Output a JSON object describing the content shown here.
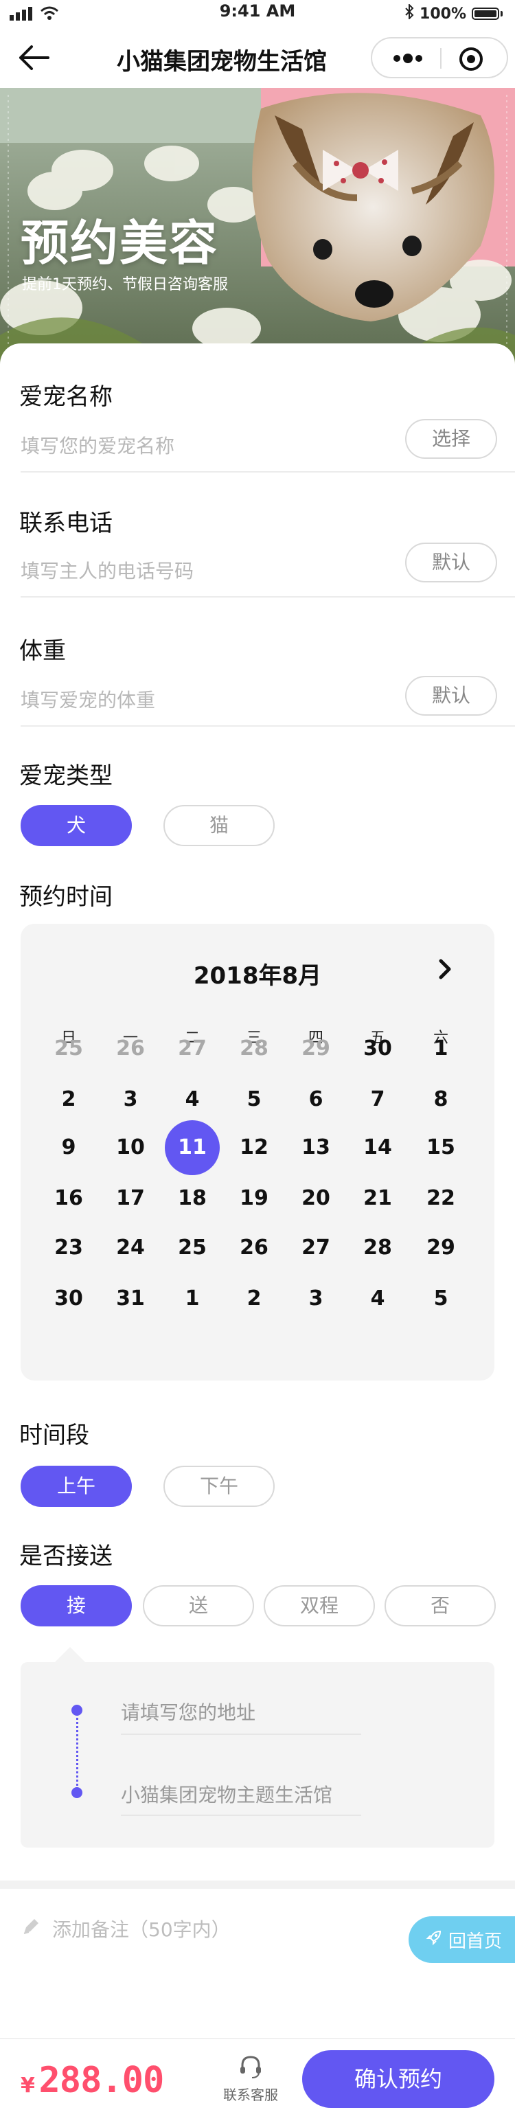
{
  "status_bar": {
    "time": "9:41 AM",
    "battery": "100%",
    "signal_icon": "signal-icon",
    "wifi_icon": "wifi-icon",
    "bluetooth_icon": "bluetooth-icon"
  },
  "nav": {
    "title": "小猫集团宠物生活馆",
    "back_icon": "back-arrow-icon",
    "more_icon": "more-dots-icon",
    "close_icon": "close-target-icon"
  },
  "hero": {
    "title": "预约美容",
    "subtitle": "提前1天预约、节假日咨询客服"
  },
  "form": {
    "pet_name": {
      "label": "爱宠名称",
      "placeholder": "填写您的爱宠名称",
      "button": "选择"
    },
    "phone": {
      "label": "联系电话",
      "placeholder": "填写主人的电话号码",
      "button": "默认"
    },
    "weight": {
      "label": "体重",
      "placeholder": "填写爱宠的体重",
      "button": "默认"
    },
    "pet_type": {
      "label": "爱宠类型",
      "options": [
        "犬",
        "猫"
      ],
      "selected": "犬"
    },
    "date": {
      "label": "预约时间"
    },
    "period": {
      "label": "时间段",
      "options": [
        "上午",
        "下午"
      ],
      "selected": "上午"
    },
    "pickup": {
      "label": "是否接送",
      "options": [
        "接",
        "送",
        "双程",
        "否"
      ],
      "selected": "接"
    },
    "address": {
      "from_placeholder": "请填写您的地址",
      "to": "小猫集团宠物主题生活馆"
    },
    "note": {
      "placeholder": "添加备注（50字内）",
      "icon": "pencil-icon"
    }
  },
  "calendar": {
    "month_title": "2018年8月",
    "next_icon": "chevron-right-icon",
    "weekdays": [
      "日",
      "一",
      "二",
      "三",
      "四",
      "五",
      "六"
    ],
    "selected_day": "11",
    "weeks": [
      [
        {
          "d": "25",
          "dim": true
        },
        {
          "d": "26",
          "dim": true
        },
        {
          "d": "27",
          "dim": true
        },
        {
          "d": "28",
          "dim": true
        },
        {
          "d": "29",
          "dim": true
        },
        {
          "d": "30"
        },
        {
          "d": "1"
        }
      ],
      [
        {
          "d": "2"
        },
        {
          "d": "3"
        },
        {
          "d": "4"
        },
        {
          "d": "5"
        },
        {
          "d": "6"
        },
        {
          "d": "7"
        },
        {
          "d": "8"
        }
      ],
      [
        {
          "d": "9"
        },
        {
          "d": "10"
        },
        {
          "d": "11"
        },
        {
          "d": "12"
        },
        {
          "d": "13"
        },
        {
          "d": "14"
        },
        {
          "d": "15"
        }
      ],
      [
        {
          "d": "16"
        },
        {
          "d": "17"
        },
        {
          "d": "18"
        },
        {
          "d": "19"
        },
        {
          "d": "20"
        },
        {
          "d": "21"
        },
        {
          "d": "22"
        }
      ],
      [
        {
          "d": "23"
        },
        {
          "d": "24"
        },
        {
          "d": "25"
        },
        {
          "d": "26"
        },
        {
          "d": "27"
        },
        {
          "d": "28"
        },
        {
          "d": "29"
        }
      ],
      [
        {
          "d": "30"
        },
        {
          "d": "31"
        },
        {
          "d": "1"
        },
        {
          "d": "2"
        },
        {
          "d": "3"
        },
        {
          "d": "4"
        },
        {
          "d": "5"
        }
      ]
    ]
  },
  "floating": {
    "back_home": "回首页",
    "rocket_icon": "rocket-icon"
  },
  "footer": {
    "currency": "¥",
    "price": "288.00",
    "service_label": "联系客服",
    "service_icon": "headset-icon",
    "confirm": "确认预约"
  },
  "colors": {
    "accent": "#6257f2",
    "price": "#ff4f6d",
    "float_button": "#6fcff0"
  }
}
